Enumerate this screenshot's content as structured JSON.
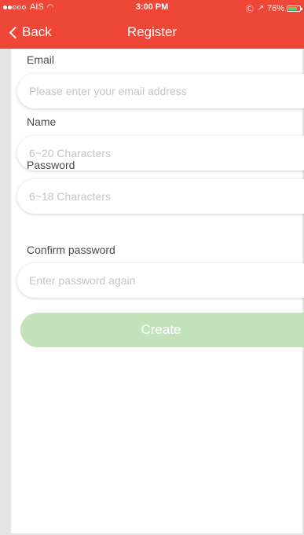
{
  "status_bar": {
    "carrier": "AIS",
    "time": "3:00 PM",
    "battery_text": "76%",
    "battery_level": 0.76,
    "signal_full_dots": 2,
    "signal_empty_dots": 3
  },
  "nav": {
    "back_label": "Back",
    "title": "Register"
  },
  "form": {
    "email": {
      "label": "Email",
      "placeholder": "Please enter your email address"
    },
    "name": {
      "label": "Name",
      "placeholder": "6~20 Characters"
    },
    "password": {
      "label": "Password",
      "placeholder": "6~18 Characters"
    },
    "confirm": {
      "label": "Confirm password",
      "placeholder": "Enter password again"
    },
    "create_label": "Create"
  },
  "colors": {
    "accent": "#ee4637",
    "button_disabled": "#c3e2b9",
    "battery": "#4cd964"
  }
}
